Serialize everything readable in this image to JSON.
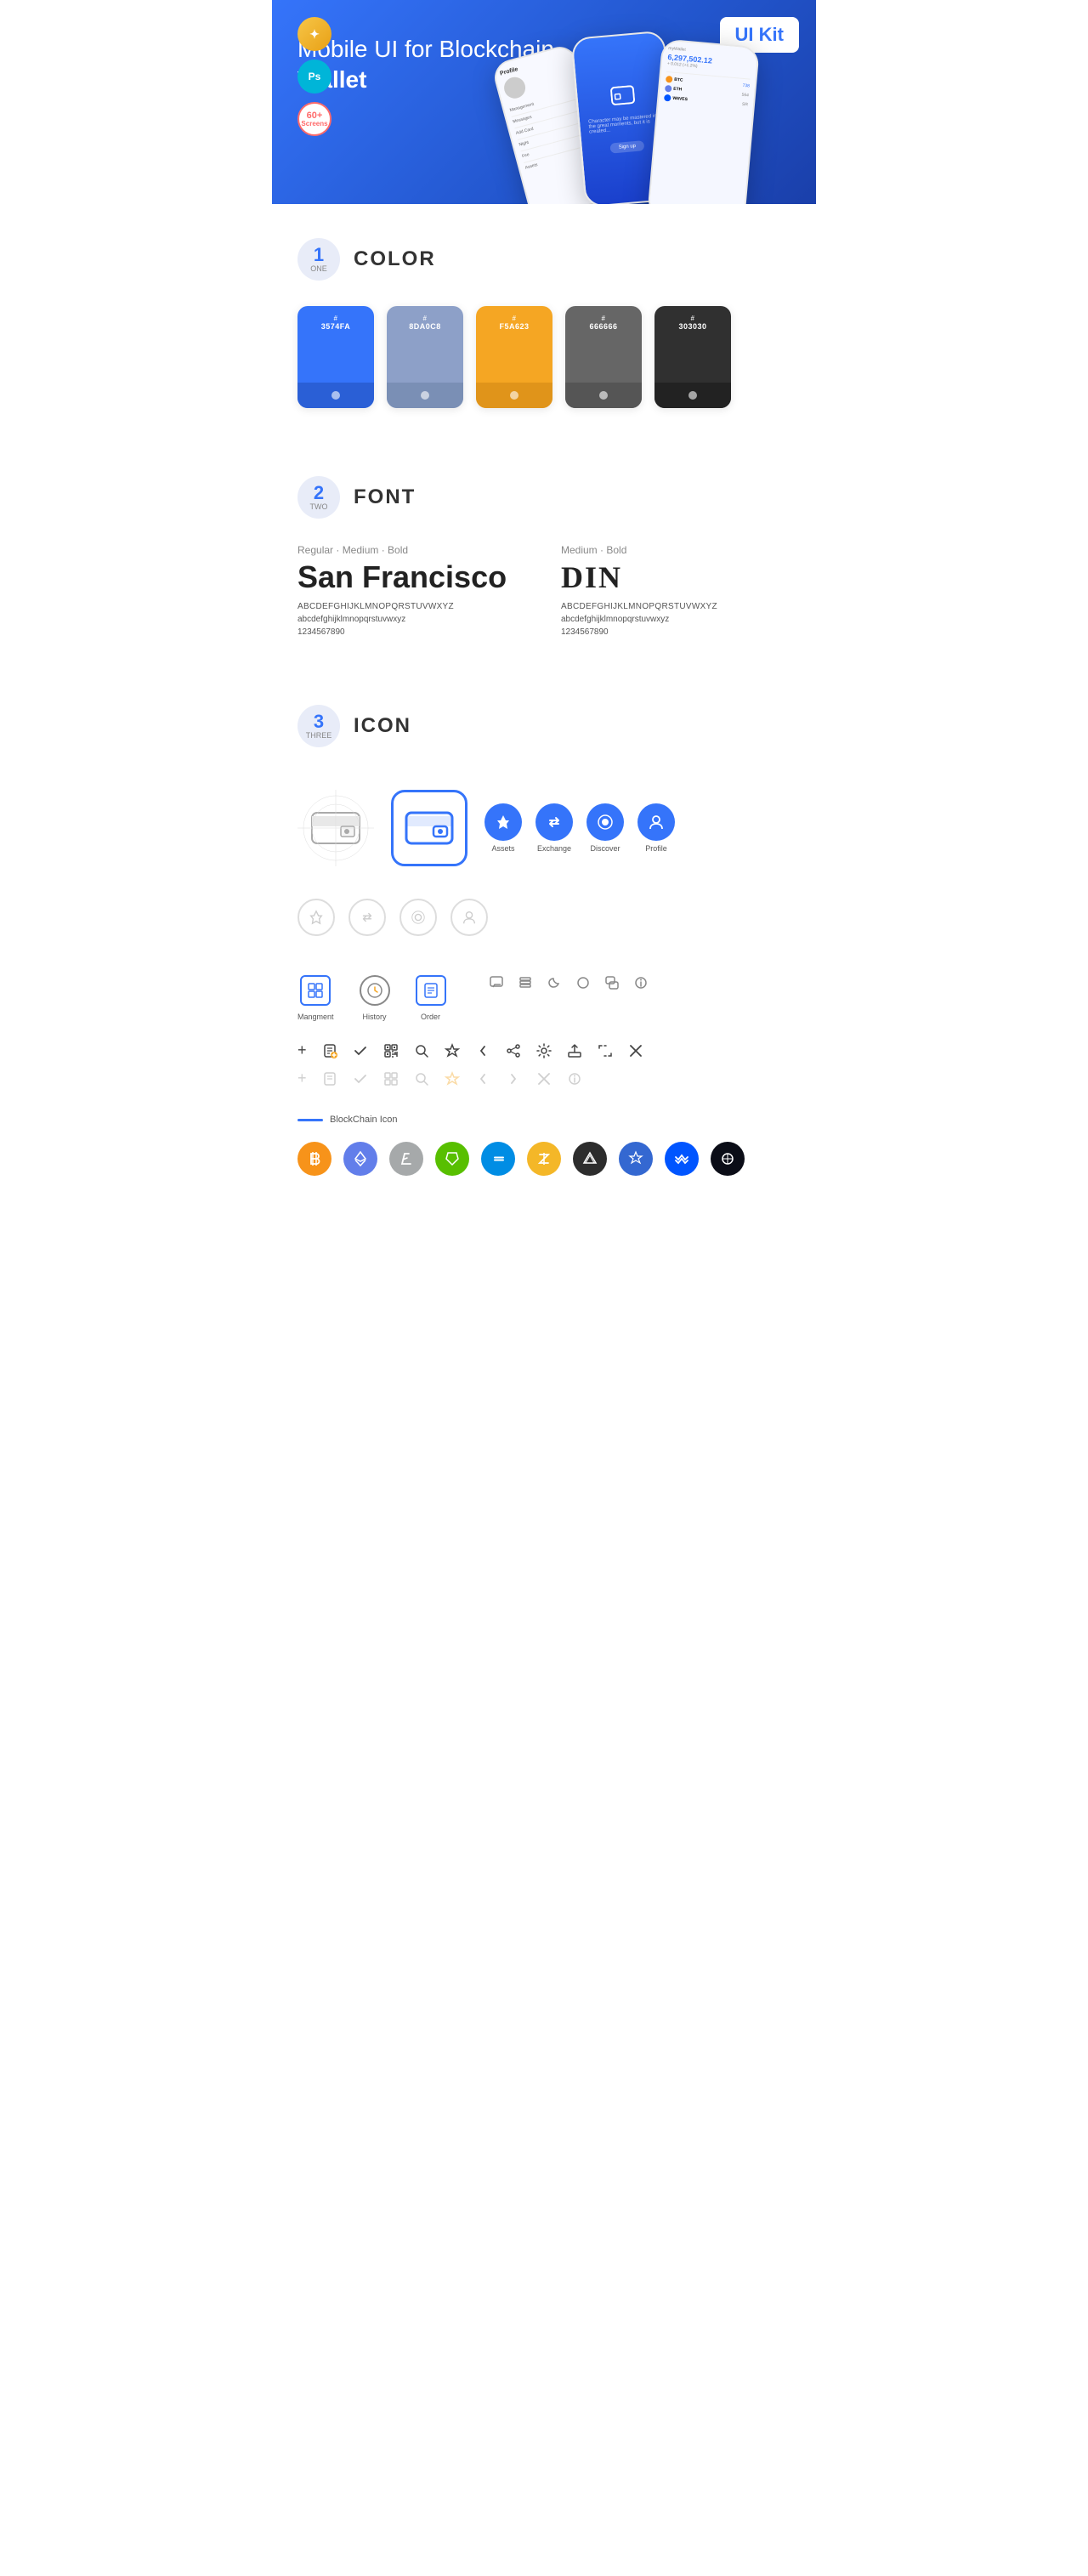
{
  "hero": {
    "title": "Mobile UI for Blockchain ",
    "title_bold": "Wallet",
    "badge": "UI Kit",
    "sketch_label": "Sk",
    "ps_label": "Ps",
    "screens_top": "60+",
    "screens_bottom": "Screens"
  },
  "sections": {
    "color": {
      "number": "1",
      "sub": "ONE",
      "title": "COLOR",
      "swatches": [
        {
          "hex": "#",
          "code": "3574FA",
          "color": "#3574FA",
          "bottom_bg": "#2a5fd6"
        },
        {
          "hex": "#",
          "code": "8DA0C8",
          "color": "#8DA0C8",
          "bottom_bg": "#7a8fb5"
        },
        {
          "hex": "#",
          "code": "F5A623",
          "color": "#F5A623",
          "bottom_bg": "#e0941a"
        },
        {
          "hex": "#",
          "code": "666666",
          "color": "#666666",
          "bottom_bg": "#555555"
        },
        {
          "hex": "#",
          "code": "303030",
          "color": "#303030",
          "bottom_bg": "#222222"
        }
      ]
    },
    "font": {
      "number": "2",
      "sub": "TWO",
      "title": "FONT",
      "font1": {
        "style": "Regular · Medium · Bold",
        "name": "San Francisco",
        "upper": "ABCDEFGHIJKLMNOPQRSTUVWXYZ",
        "lower": "abcdefghijklmnopqrstuvwxyz",
        "numbers": "1234567890"
      },
      "font2": {
        "style": "Medium · Bold",
        "name": "DIN",
        "upper": "ABCDEFGHIJKLMNOPQRSTUVWXYZ",
        "lower": "abcdefghijklmnopqrstuvwxyz",
        "numbers": "1234567890"
      }
    },
    "icon": {
      "number": "3",
      "sub": "THREE",
      "title": "ICON",
      "nav_items": [
        {
          "label": "Assets",
          "icon": "◆"
        },
        {
          "label": "Exchange",
          "icon": "⇄"
        },
        {
          "label": "Discover",
          "icon": "●"
        },
        {
          "label": "Profile",
          "icon": "👤"
        }
      ],
      "bottom_nav": [
        {
          "label": "Mangment",
          "type": "rect"
        },
        {
          "label": "History",
          "type": "circle"
        },
        {
          "label": "Order",
          "type": "rect"
        }
      ],
      "blockchain_label": "BlockChain Icon"
    }
  },
  "crypto_coins": [
    {
      "symbol": "₿",
      "class": "crypto-btc",
      "name": "Bitcoin"
    },
    {
      "symbol": "Ξ",
      "class": "crypto-eth",
      "name": "Ethereum"
    },
    {
      "symbol": "Ł",
      "class": "crypto-ltc",
      "name": "Litecoin"
    },
    {
      "symbol": "N",
      "class": "crypto-neo",
      "name": "NEO"
    },
    {
      "symbol": "D",
      "class": "crypto-dash",
      "name": "Dash"
    },
    {
      "symbol": "Z",
      "class": "crypto-zcash",
      "name": "Zcash"
    },
    {
      "symbol": "◈",
      "class": "crypto-iota",
      "name": "IOTA"
    },
    {
      "symbol": "A",
      "class": "crypto-cardano",
      "name": "Cardano"
    },
    {
      "symbol": "W",
      "class": "crypto-waves",
      "name": "Waves"
    },
    {
      "symbol": "G",
      "class": "crypto-golem",
      "name": "Golem"
    }
  ]
}
